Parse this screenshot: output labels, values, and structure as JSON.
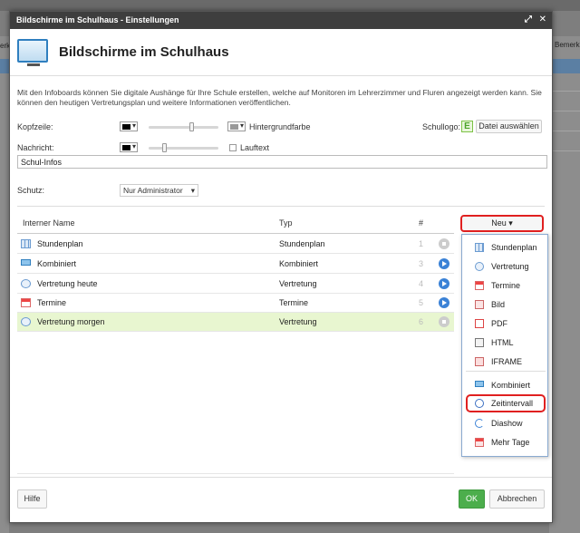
{
  "background": {
    "bemerkung": "Bemerku",
    "left_fragment": "erk"
  },
  "dialog": {
    "title": "Bildschirme im Schulhaus - Einstellungen",
    "heading": "Bildschirme im Schulhaus",
    "intro": "Mit den Infoboards können Sie digitale Aushänge für Ihre Schule erstellen, welche auf Monitoren im Lehrerzimmer und Fluren angezeigt werden kann. Sie können den heutigen Vertretungsplan und weitere Informationen veröffentlichen."
  },
  "settings": {
    "kopfzeile_label": "Kopfzeile:",
    "hintergrund_label": "Hintergrundfarbe",
    "schullogo_label": "Schullogo:",
    "datei_button": "Datei auswählen",
    "nachricht_label": "Nachricht:",
    "lauftext_label": "Lauftext",
    "nachricht_value": "Schul-Infos",
    "schutz_label": "Schutz:",
    "schutz_value": "Nur Administrator"
  },
  "table": {
    "headers": {
      "name": "Interner Name",
      "type": "Typ",
      "num": "#"
    },
    "rows": [
      {
        "name": "Stundenplan",
        "type": "Stundenplan",
        "num": "1",
        "icon": "grid-icon"
      },
      {
        "name": "Kombiniert",
        "type": "Kombiniert",
        "num": "3",
        "icon": "monitor-icon"
      },
      {
        "name": "Vertretung heute",
        "type": "Vertretung",
        "num": "4",
        "icon": "vertretung-icon"
      },
      {
        "name": "Termine",
        "type": "Termine",
        "num": "5",
        "icon": "calendar-icon"
      },
      {
        "name": "Vertretung morgen",
        "type": "Vertretung",
        "num": "6",
        "icon": "vertretung-icon"
      }
    ]
  },
  "neu": {
    "button_label": "Neu ▾",
    "items": [
      "Stundenplan",
      "Vertretung",
      "Termine",
      "Bild",
      "PDF",
      "HTML",
      "IFRAME",
      "Kombiniert",
      "Zeitintervall",
      "Diashow",
      "Mehr Tage"
    ]
  },
  "footer": {
    "hilfe": "Hilfe",
    "ok": "OK",
    "abbrechen": "Abbrechen"
  }
}
